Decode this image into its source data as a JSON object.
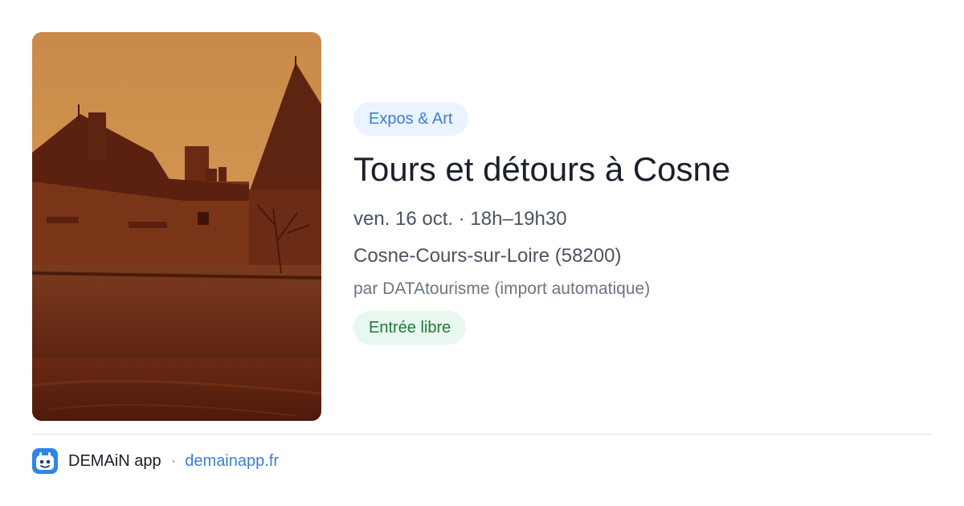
{
  "event": {
    "category": "Expos & Art",
    "title": "Tours et détours à Cosne",
    "when": "ven. 16 oct. · 18h–19h30",
    "location": "Cosne-Cours-sur-Loire (58200)",
    "organizer": "par DATAtourisme (import automatique)",
    "price": "Entrée libre",
    "image_icon": "sepia-castle-photo"
  },
  "footer": {
    "app_name": "DEMAiN app",
    "separator": "·",
    "domain": "demainapp.fr",
    "logo_icon": "demain-app-logo-icon"
  },
  "colors": {
    "category_bg": "#eaf3ff",
    "category_text": "#3d7fcf",
    "price_bg": "#e9f8ee",
    "price_text": "#1f7a3a",
    "title_text": "#1a1f2c",
    "link": "#3d7fcf",
    "logo": "#2f86e8"
  }
}
